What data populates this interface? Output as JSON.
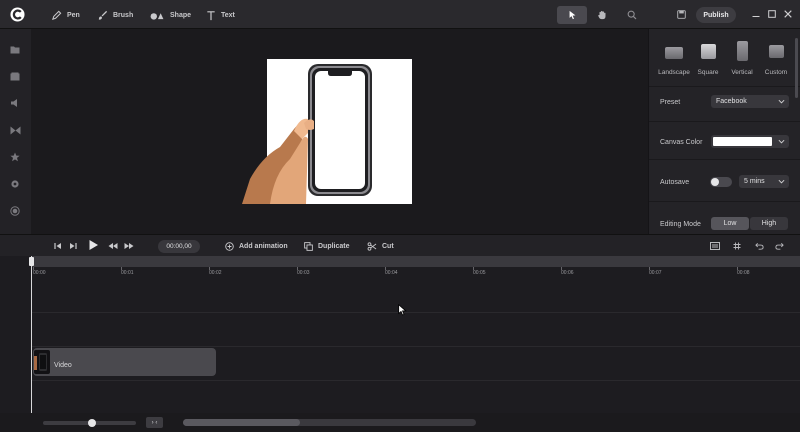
{
  "toolbar": {
    "tools": [
      {
        "icon": "pen-icon",
        "label": "Pen"
      },
      {
        "icon": "brush-icon",
        "label": "Brush"
      },
      {
        "icon": "shape-icon",
        "label": "Shape"
      },
      {
        "icon": "text-icon",
        "label": "Text"
      }
    ],
    "modes": [
      "pointer-icon",
      "hand-icon",
      "zoom-icon"
    ],
    "active_mode": "pointer-icon",
    "publish_label": "Publish"
  },
  "rail": {
    "items": [
      "folder-icon",
      "media-icon",
      "audio-icon",
      "transition-icon",
      "star-icon",
      "settings-icon",
      "record-icon"
    ]
  },
  "panel": {
    "formats": [
      {
        "label": "Landscape"
      },
      {
        "label": "Square"
      },
      {
        "label": "Vertical"
      },
      {
        "label": "Custom"
      }
    ],
    "preset_label": "Preset",
    "preset_value": "Facebook",
    "canvas_color_label": "Canvas Color",
    "canvas_color_value": "#ffffff",
    "autosave_label": "Autosave",
    "autosave_on": false,
    "autosave_interval": "5 mins",
    "editing_mode_label": "Editing Mode",
    "editing_modes": [
      "Low",
      "High"
    ]
  },
  "timeline_toolbar": {
    "timecode": "00:00,00",
    "add_animation": "Add animation",
    "duplicate": "Duplicate",
    "cut": "Cut"
  },
  "timeline": {
    "ticks": [
      "00:00",
      "00:01",
      "00:02",
      "00:03",
      "00:04",
      "00:05",
      "00:06",
      "00:07",
      "00:08"
    ],
    "clip_label": "Video"
  },
  "bottom": {
    "zoom_fraction": 0.5,
    "zoom_toggle": "› ‹"
  },
  "colors": {
    "background": "#1b1a1d",
    "panel": "#242327",
    "accent": "#e6e6e8"
  }
}
